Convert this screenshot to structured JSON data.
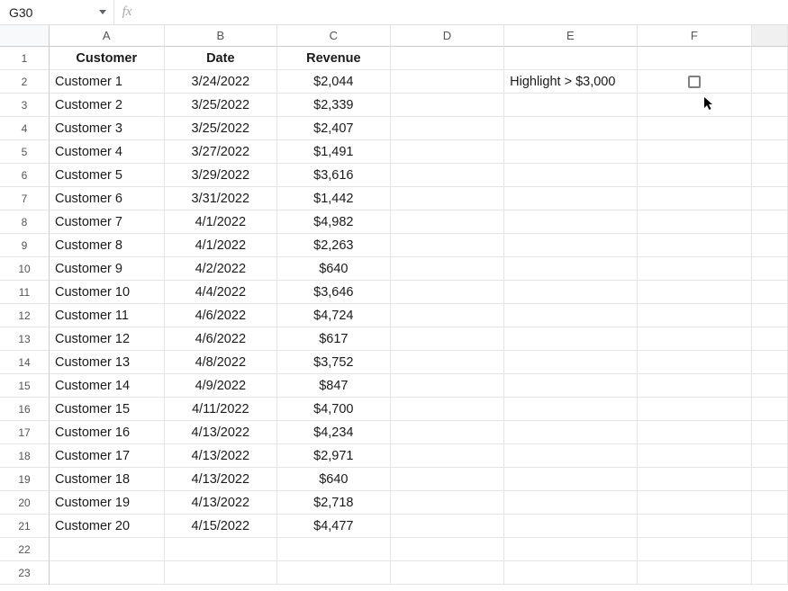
{
  "nameBox": "G30",
  "fxLabel": "fx",
  "formulaValue": "",
  "columns": [
    "A",
    "B",
    "C",
    "D",
    "E",
    "F"
  ],
  "rowNumbers": [
    1,
    2,
    3,
    4,
    5,
    6,
    7,
    8,
    9,
    10,
    11,
    12,
    13,
    14,
    15,
    16,
    17,
    18,
    19,
    20,
    21,
    22,
    23
  ],
  "headers": {
    "A": "Customer",
    "B": "Date",
    "C": "Revenue"
  },
  "sideLabel": "Highlight > $3,000",
  "checkboxChecked": false,
  "data": [
    {
      "customer": "Customer 1",
      "date": "3/24/2022",
      "revenue": "$2,044"
    },
    {
      "customer": "Customer 2",
      "date": "3/25/2022",
      "revenue": "$2,339"
    },
    {
      "customer": "Customer 3",
      "date": "3/25/2022",
      "revenue": "$2,407"
    },
    {
      "customer": "Customer 4",
      "date": "3/27/2022",
      "revenue": "$1,491"
    },
    {
      "customer": "Customer 5",
      "date": "3/29/2022",
      "revenue": "$3,616"
    },
    {
      "customer": "Customer 6",
      "date": "3/31/2022",
      "revenue": "$1,442"
    },
    {
      "customer": "Customer 7",
      "date": "4/1/2022",
      "revenue": "$4,982"
    },
    {
      "customer": "Customer 8",
      "date": "4/1/2022",
      "revenue": "$2,263"
    },
    {
      "customer": "Customer 9",
      "date": "4/2/2022",
      "revenue": "$640"
    },
    {
      "customer": "Customer 10",
      "date": "4/4/2022",
      "revenue": "$3,646"
    },
    {
      "customer": "Customer 11",
      "date": "4/6/2022",
      "revenue": "$4,724"
    },
    {
      "customer": "Customer 12",
      "date": "4/6/2022",
      "revenue": "$617"
    },
    {
      "customer": "Customer 13",
      "date": "4/8/2022",
      "revenue": "$3,752"
    },
    {
      "customer": "Customer 14",
      "date": "4/9/2022",
      "revenue": "$847"
    },
    {
      "customer": "Customer 15",
      "date": "4/11/2022",
      "revenue": "$4,700"
    },
    {
      "customer": "Customer 16",
      "date": "4/13/2022",
      "revenue": "$4,234"
    },
    {
      "customer": "Customer 17",
      "date": "4/13/2022",
      "revenue": "$2,971"
    },
    {
      "customer": "Customer 18",
      "date": "4/13/2022",
      "revenue": "$640"
    },
    {
      "customer": "Customer 19",
      "date": "4/13/2022",
      "revenue": "$2,718"
    },
    {
      "customer": "Customer 20",
      "date": "4/15/2022",
      "revenue": "$4,477"
    }
  ]
}
